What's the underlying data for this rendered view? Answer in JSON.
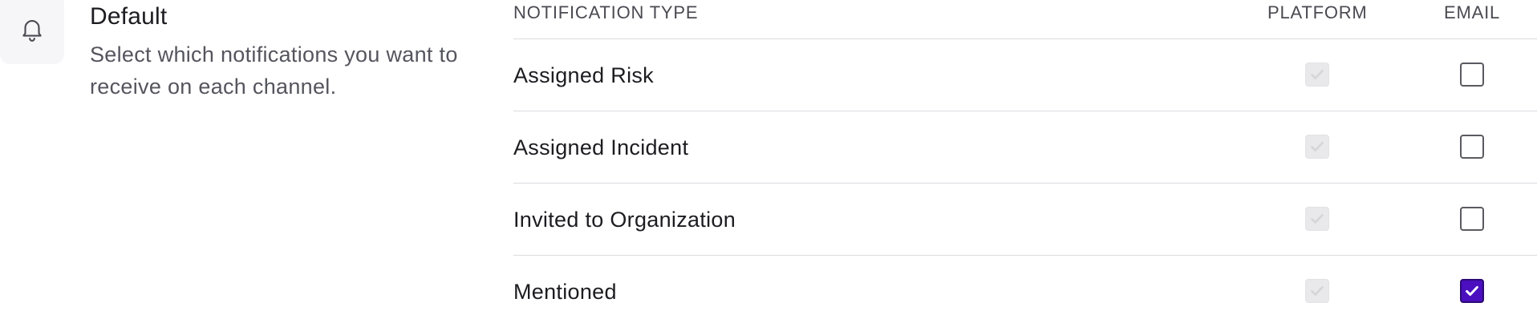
{
  "section": {
    "title": "Default",
    "description": "Select which notifications you want to receive on each channel.",
    "icon": "bell-icon"
  },
  "table": {
    "headers": {
      "type": "NOTIFICATION TYPE",
      "platform": "PLATFORM",
      "email": "EMAIL"
    },
    "rows": [
      {
        "label": "Assigned Risk",
        "platform_checked": true,
        "platform_disabled": true,
        "email_checked": false
      },
      {
        "label": "Assigned Incident",
        "platform_checked": true,
        "platform_disabled": true,
        "email_checked": false
      },
      {
        "label": "Invited to Organization",
        "platform_checked": true,
        "platform_disabled": true,
        "email_checked": false
      },
      {
        "label": "Mentioned",
        "platform_checked": true,
        "platform_disabled": true,
        "email_checked": true
      }
    ]
  },
  "colors": {
    "accent": "#4b0fbf",
    "disabled_check_bg": "#e9e9ec",
    "divider": "#dcdce0"
  }
}
